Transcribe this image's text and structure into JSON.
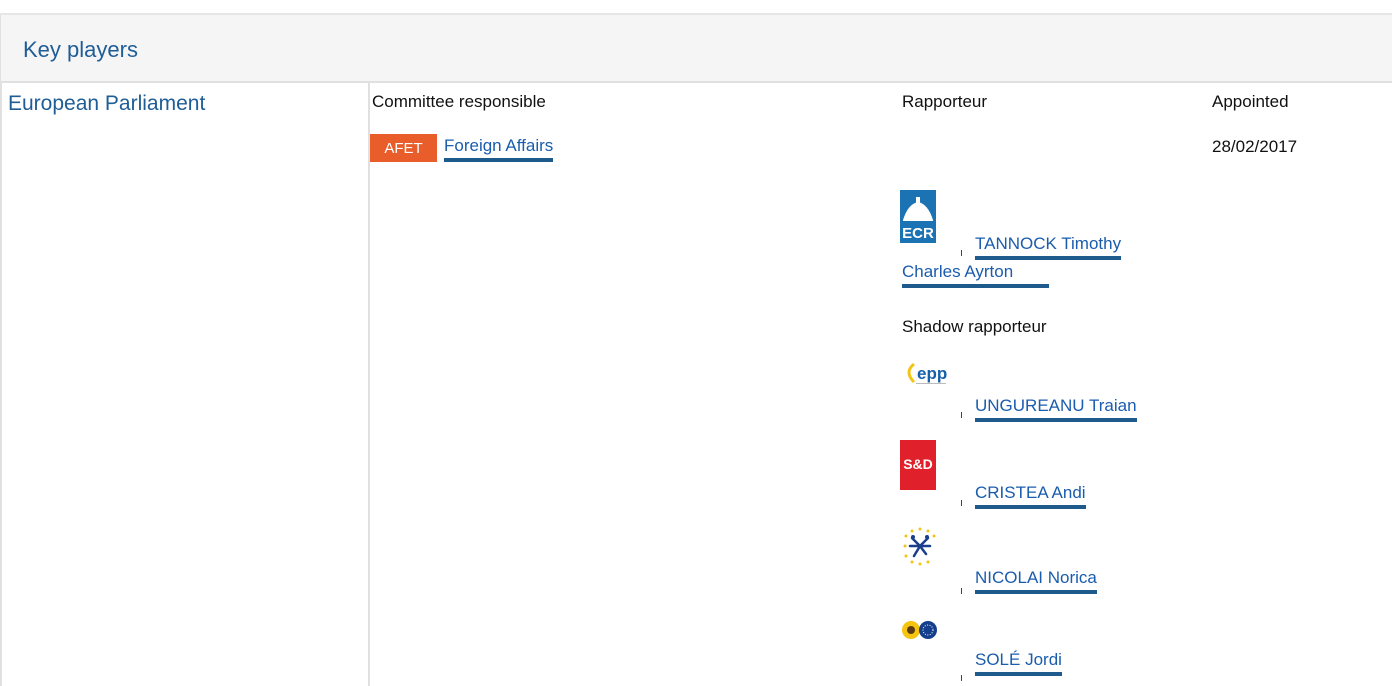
{
  "section": {
    "title": "Key players"
  },
  "institution": "European Parliament",
  "columns": {
    "committee": "Committee responsible",
    "rapporteur": "Rapporteur",
    "appointed": "Appointed"
  },
  "committee": {
    "code": "AFET",
    "name": "Foreign Affairs",
    "appointed": "28/02/2017"
  },
  "rapporteur": {
    "group": "ECR",
    "name_line1": "TANNOCK Timothy",
    "name_line2": "Charles Ayrton"
  },
  "shadow_label": "Shadow rapporteur",
  "shadows": [
    {
      "group_icon": "epp-logo-icon",
      "logo_text": "epp",
      "name": "UNGUREANU Traian"
    },
    {
      "group_icon": "sd-logo-icon",
      "logo_text": "S&D",
      "name": "CRISTEA Andi"
    },
    {
      "group_icon": "alde-logo-icon",
      "name": "NICOLAI Norica"
    },
    {
      "group_icon": "greens-efa-logo-icon",
      "name": "SOLÉ Jordi"
    }
  ],
  "colors": {
    "link": "#1a5cad",
    "badge": "#e85d2a",
    "heading": "#1f5d96"
  }
}
